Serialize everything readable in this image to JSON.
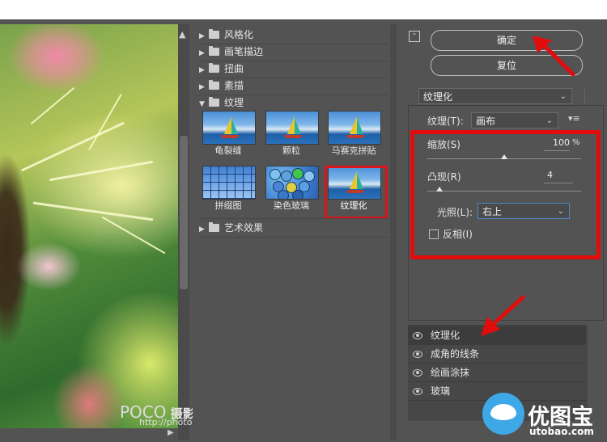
{
  "gallery": {
    "categories": [
      {
        "label": "风格化",
        "expanded": false
      },
      {
        "label": "画笔描边",
        "expanded": false
      },
      {
        "label": "扭曲",
        "expanded": false
      },
      {
        "label": "素描",
        "expanded": false
      },
      {
        "label": "纹理",
        "expanded": true
      },
      {
        "label": "艺术效果",
        "expanded": false
      }
    ],
    "textures": [
      {
        "label": "龟裂缝"
      },
      {
        "label": "颗粒"
      },
      {
        "label": "马赛克拼贴"
      },
      {
        "label": "拼缀图"
      },
      {
        "label": "染色玻璃"
      },
      {
        "label": "纹理化",
        "selected": true
      }
    ]
  },
  "buttons": {
    "ok": "确定",
    "reset": "复位"
  },
  "filter_select": {
    "value": "纹理化"
  },
  "options": {
    "texture_label": "纹理(T):",
    "texture_value": "画布",
    "scaling_label": "缩放(S)",
    "scaling_value": "100",
    "scaling_unit": "%",
    "scaling_level": 0.5,
    "relief_label": "凸现(R)",
    "relief_value": "4",
    "relief_level": 0.08,
    "light_label": "光照(L):",
    "light_value": "右上",
    "invert_label": "反相(I)",
    "invert_checked": false
  },
  "layers": [
    {
      "label": "纹理化",
      "active": true
    },
    {
      "label": "成角的线条",
      "active": false
    },
    {
      "label": "绘画涂抹",
      "active": false
    },
    {
      "label": "玻璃",
      "active": false
    }
  ],
  "watermark": {
    "brand": "POCO",
    "text": "摄影专题",
    "url": "http://photo.poco.cn/"
  },
  "site_logo": {
    "name": "优图宝",
    "domain": "utobao.com"
  },
  "colors": {
    "highlight_red": "#e10d0d",
    "panel_bg": "#535353"
  }
}
